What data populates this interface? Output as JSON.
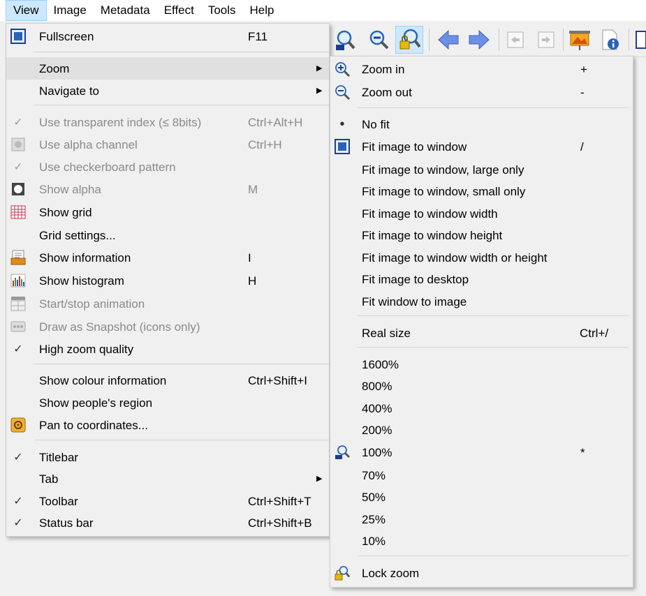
{
  "menubar": [
    "View",
    "Image",
    "Metadata",
    "Effect",
    "Tools",
    "Help"
  ],
  "view_menu": {
    "fullscreen": {
      "label": "Fullscreen",
      "shortcut": "F11"
    },
    "zoom": {
      "label": "Zoom"
    },
    "navigate": {
      "label": "Navigate to"
    },
    "transparent_index": {
      "label": "Use transparent index (≤ 8bits)",
      "shortcut": "Ctrl+Alt+H"
    },
    "alpha_channel": {
      "label": "Use alpha channel",
      "shortcut": "Ctrl+H"
    },
    "checkerboard": {
      "label": "Use checkerboard pattern"
    },
    "show_alpha": {
      "label": "Show alpha",
      "shortcut": "M"
    },
    "show_grid": {
      "label": "Show grid"
    },
    "grid_settings": {
      "label": "Grid settings..."
    },
    "show_information": {
      "label": "Show information",
      "shortcut": "I"
    },
    "show_histogram": {
      "label": "Show histogram",
      "shortcut": "H"
    },
    "animation": {
      "label": "Start/stop animation"
    },
    "snapshot": {
      "label": "Draw as Snapshot (icons only)"
    },
    "zoom_quality": {
      "label": "High zoom quality"
    },
    "colour_info": {
      "label": "Show colour information",
      "shortcut": "Ctrl+Shift+I"
    },
    "people_region": {
      "label": "Show people's region"
    },
    "pan": {
      "label": "Pan to coordinates..."
    },
    "titlebar": {
      "label": "Titlebar"
    },
    "tab": {
      "label": "Tab"
    },
    "toolbar": {
      "label": "Toolbar",
      "shortcut": "Ctrl+Shift+T"
    },
    "status_bar": {
      "label": "Status bar",
      "shortcut": "Ctrl+Shift+B"
    }
  },
  "zoom_menu": {
    "zoom_in": {
      "label": "Zoom in",
      "shortcut": "+"
    },
    "zoom_out": {
      "label": "Zoom out",
      "shortcut": "-"
    },
    "no_fit": {
      "label": "No fit"
    },
    "fit_window": {
      "label": "Fit image to window",
      "shortcut": "/"
    },
    "fit_large": {
      "label": "Fit image to window, large only"
    },
    "fit_small": {
      "label": "Fit image to window, small only"
    },
    "fit_width": {
      "label": "Fit image to window width"
    },
    "fit_height": {
      "label": "Fit image to window height"
    },
    "fit_wh": {
      "label": "Fit image to window width or height"
    },
    "fit_desktop": {
      "label": "Fit image to desktop"
    },
    "fit_window_to_image": {
      "label": "Fit window to image"
    },
    "real_size": {
      "label": "Real size",
      "shortcut": "Ctrl+/"
    },
    "p1600": {
      "label": "1600%"
    },
    "p800": {
      "label": "800%"
    },
    "p400": {
      "label": "400%"
    },
    "p200": {
      "label": "200%"
    },
    "p100": {
      "label": "100%",
      "shortcut": "*"
    },
    "p70": {
      "label": "70%"
    },
    "p50": {
      "label": "50%"
    },
    "p25": {
      "label": "25%"
    },
    "p10": {
      "label": "10%"
    },
    "lock_zoom": {
      "label": "Lock zoom"
    }
  },
  "icons": {
    "check": "✓",
    "bullet": "•",
    "submenu": "▶"
  },
  "colors": {
    "highlight": "#e0e0e0",
    "menubar_active": "#cce8ff",
    "disabled_text": "#8a8a8a"
  }
}
